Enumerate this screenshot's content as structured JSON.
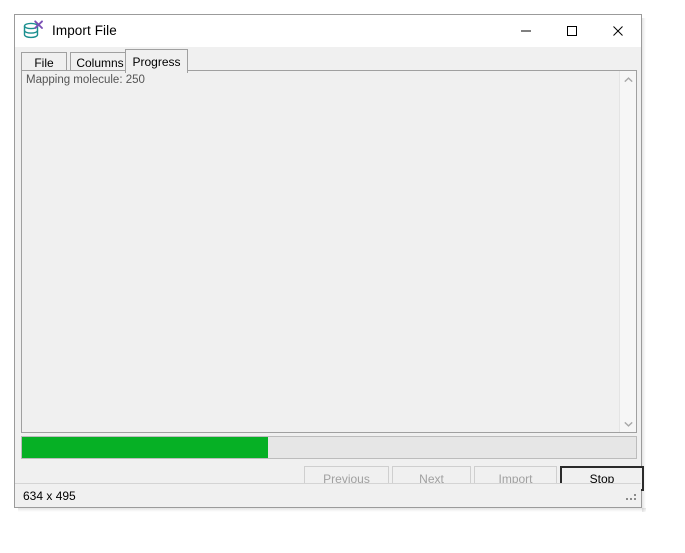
{
  "window": {
    "title": "Import File",
    "icon": "database-x-icon",
    "controls": [
      {
        "name": "minimize-button",
        "glyph": "minimize-icon",
        "label": "Minimize"
      },
      {
        "name": "maximize-button",
        "glyph": "maximize-icon",
        "label": "Maximize"
      },
      {
        "name": "close-button",
        "glyph": "close-icon",
        "label": "Close"
      }
    ]
  },
  "tabs": [
    {
      "label": "File",
      "selected": false
    },
    {
      "label": "Columns",
      "selected": false
    },
    {
      "label": "Progress",
      "selected": true
    }
  ],
  "log": {
    "lines": "Mapping molecule: 250",
    "scrollbar": {
      "up_arrow": "chevron-up-icon",
      "down_arrow": "chevron-down-icon"
    }
  },
  "progress": {
    "percent": 40,
    "fill_width_css": "40%",
    "color": "#06b025",
    "track_color": "#e6e6e6"
  },
  "buttons": [
    {
      "label": "Previous",
      "state": "disabled"
    },
    {
      "label": "Next",
      "state": "disabled"
    },
    {
      "label": "Import",
      "state": "disabled"
    },
    {
      "label": "Stop",
      "state": "default"
    }
  ],
  "statusbar": {
    "size_text": "634 x 495",
    "grip": "resize-grip-icon"
  }
}
